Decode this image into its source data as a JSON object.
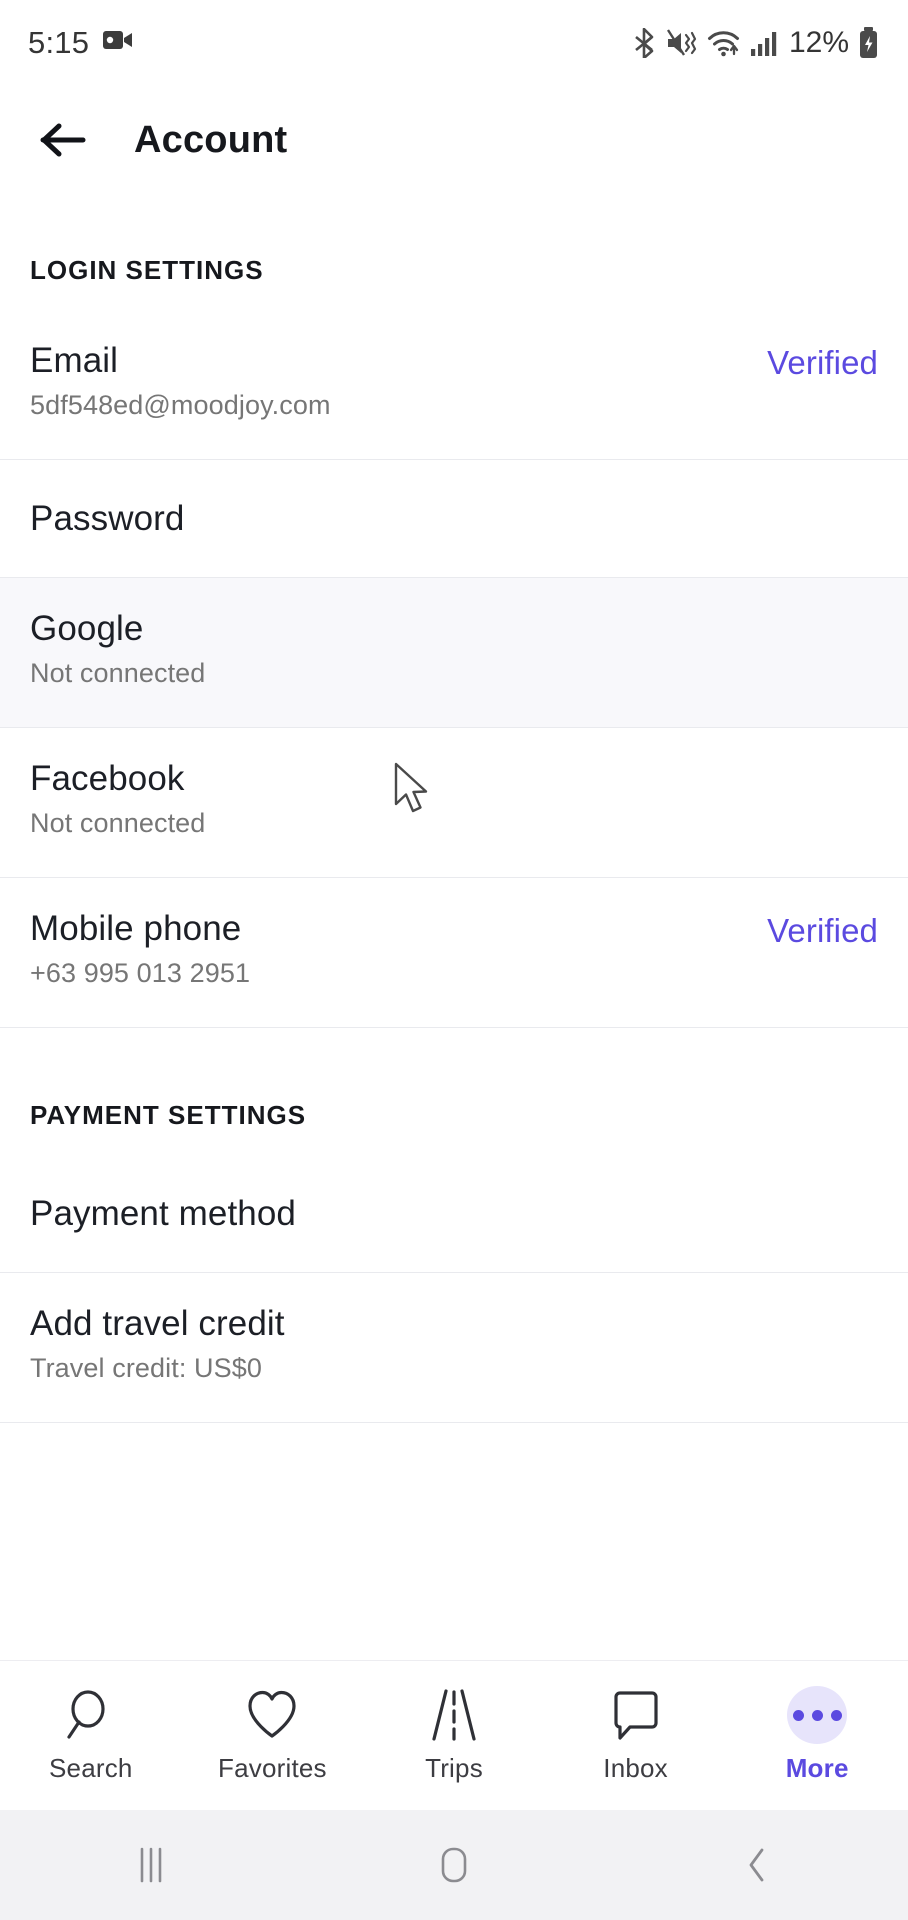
{
  "status_bar": {
    "clock": "5:15",
    "battery_percent": "12%",
    "icons": [
      "video-camera-icon",
      "bluetooth-icon",
      "mute-vibrate-icon",
      "wifi-icon",
      "cellular-signal-icon",
      "battery-charging-icon"
    ]
  },
  "app_bar": {
    "back_label": "back-arrow",
    "title": "Account"
  },
  "sections": [
    {
      "header": "LOGIN SETTINGS",
      "rows": [
        {
          "title": "Email",
          "subtitle": "5df548ed@moodjoy.com",
          "status": "Verified",
          "hover": false
        },
        {
          "title": "Password",
          "subtitle": "",
          "status": "",
          "hover": false
        },
        {
          "title": "Google",
          "subtitle": "Not connected",
          "status": "",
          "hover": true
        },
        {
          "title": "Facebook",
          "subtitle": "Not connected",
          "status": "",
          "hover": false
        },
        {
          "title": "Mobile phone",
          "subtitle": "+63 995 013 2951",
          "status": "Verified",
          "hover": false
        }
      ]
    },
    {
      "header": "PAYMENT SETTINGS",
      "rows": [
        {
          "title": "Payment method",
          "subtitle": "",
          "status": "",
          "hover": false
        },
        {
          "title": "Add travel credit",
          "subtitle": "Travel credit: US$0",
          "status": "",
          "hover": false
        }
      ]
    }
  ],
  "tab_bar": {
    "items": [
      {
        "label": "Search",
        "icon": "search-icon",
        "active": false
      },
      {
        "label": "Favorites",
        "icon": "heart-icon",
        "active": false
      },
      {
        "label": "Trips",
        "icon": "road-icon",
        "active": false
      },
      {
        "label": "Inbox",
        "icon": "chat-bubble-icon",
        "active": false
      },
      {
        "label": "More",
        "icon": "more-dots-icon",
        "active": true
      }
    ]
  },
  "system_nav": {
    "recents": "recents-icon",
    "home": "home-icon",
    "back": "back-chevron-icon"
  },
  "colors": {
    "accent": "#5b4ae0",
    "accent_soft": "#e7e4fb",
    "text_primary": "#1c1f26",
    "text_secondary": "#767676",
    "divider": "#e9eaee",
    "hover_row": "#f8f8fb",
    "sysnav_bg": "#f2f2f4"
  }
}
